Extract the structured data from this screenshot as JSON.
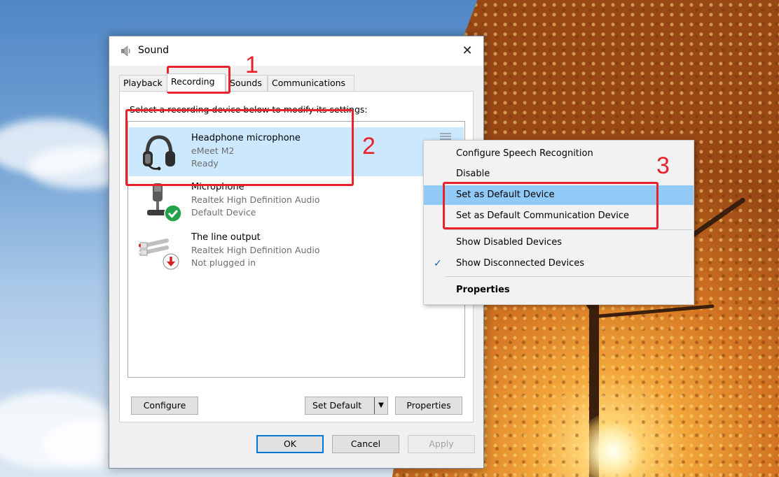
{
  "dialog": {
    "title": "Sound",
    "close_glyph": "✕",
    "tabs": [
      {
        "label": "Playback"
      },
      {
        "label": "Recording"
      },
      {
        "label": "Sounds"
      },
      {
        "label": "Communications"
      }
    ],
    "active_tab": "Recording",
    "instruction": "Select a recording device below to modify its settings:",
    "devices": [
      {
        "name": "Headphone microphone",
        "sub": "eMeet M2",
        "status": "Ready",
        "icon": "headset-icon",
        "selected": true
      },
      {
        "name": "Microphone",
        "sub": "Realtek High Definition Audio",
        "status": "Default Device",
        "icon": "microphone-icon",
        "badge": "green-check-icon"
      },
      {
        "name": "The line output",
        "sub": "Realtek High Definition Audio",
        "status": "Not plugged in",
        "icon": "rca-cable-icon",
        "badge": "red-down-arrow-icon"
      }
    ],
    "buttons": {
      "configure": "Configure",
      "set_default": "Set Default",
      "set_default_arrow": "▼",
      "properties": "Properties",
      "ok": "OK",
      "cancel": "Cancel",
      "apply": "Apply"
    }
  },
  "context_menu": {
    "items": [
      {
        "label": "Configure Speech Recognition"
      },
      {
        "label": "Disable"
      },
      {
        "label": "Set as Default Device",
        "highlighted": true
      },
      {
        "label": "Set as Default Communication Device"
      },
      {
        "label": "Show Disabled Devices"
      },
      {
        "label": "Show Disconnected Devices",
        "checked": true,
        "check_glyph": "✓"
      },
      {
        "label": "Properties",
        "bold": true
      }
    ]
  },
  "annotations": {
    "step1": "1",
    "step2": "2",
    "step3": "3",
    "color": "#e8212a"
  },
  "colors": {
    "selection": "#cce8ff",
    "menu_highlight": "#91c9f7",
    "accent": "#0078d7"
  }
}
